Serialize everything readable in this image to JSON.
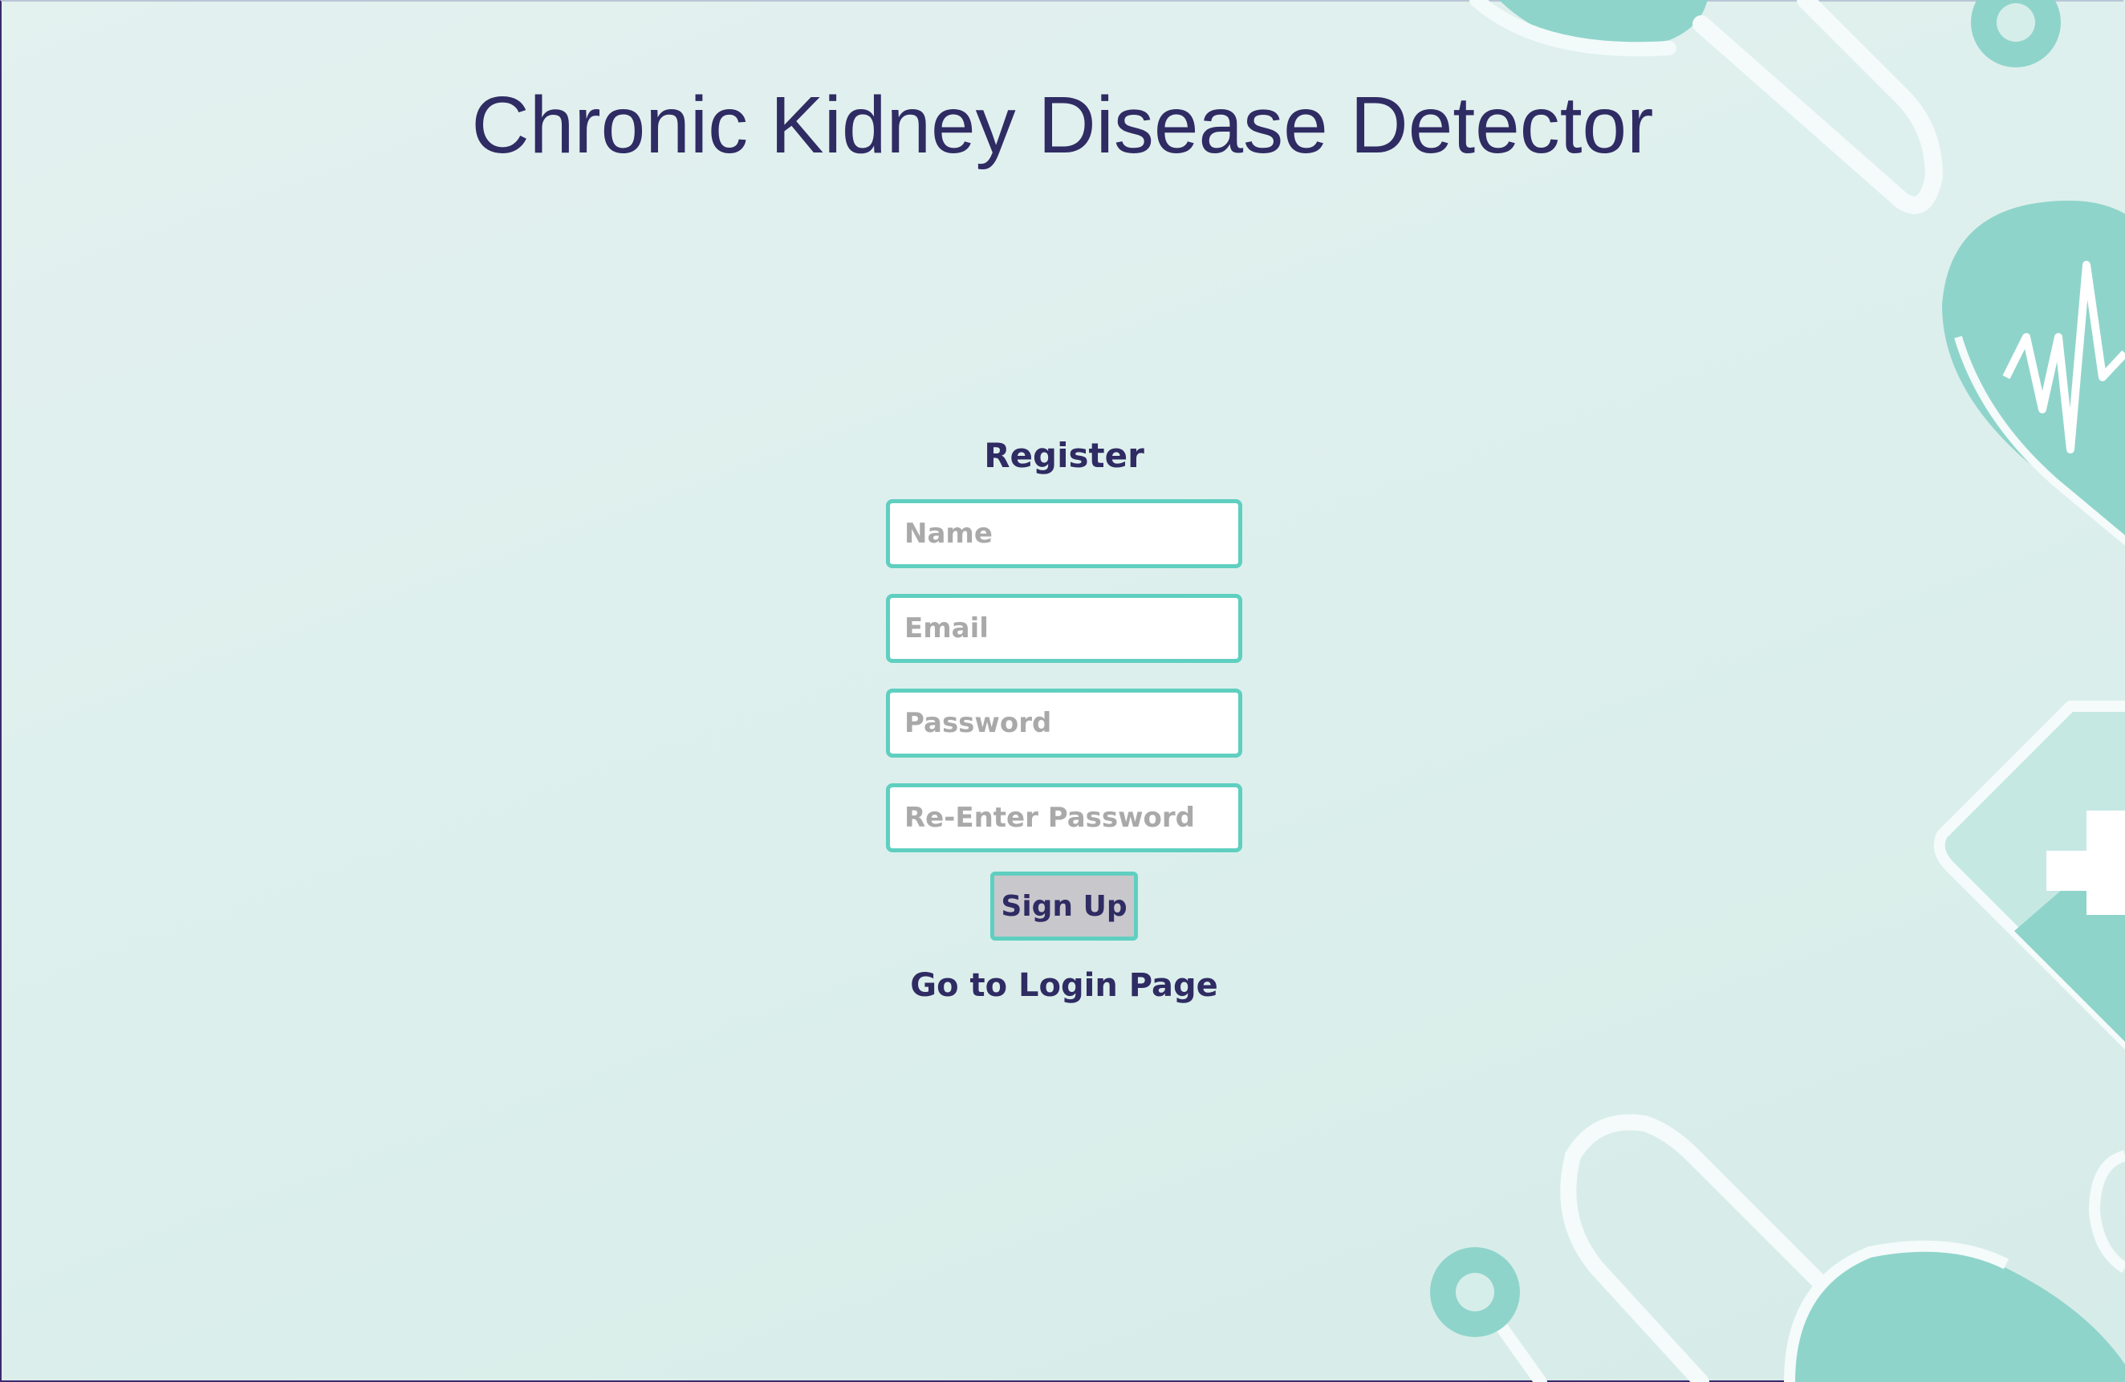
{
  "page": {
    "title": "Chronic Kidney Disease Detector"
  },
  "form": {
    "heading": "Register",
    "fields": {
      "name_placeholder": "Name",
      "email_placeholder": "Email",
      "password_placeholder": "Password",
      "reenter_password_placeholder": "Re-Enter Password"
    },
    "signup_label": "Sign Up",
    "login_link_label": "Go to Login Page"
  },
  "colors": {
    "text_primary": "#2f2b63",
    "field_border": "#5fcfc0",
    "decor_teal": "#8fd4cb",
    "background": "#dff0ed"
  },
  "icons": [
    "stethoscope-icon",
    "heart-pulse-icon",
    "medical-cross-icon"
  ]
}
